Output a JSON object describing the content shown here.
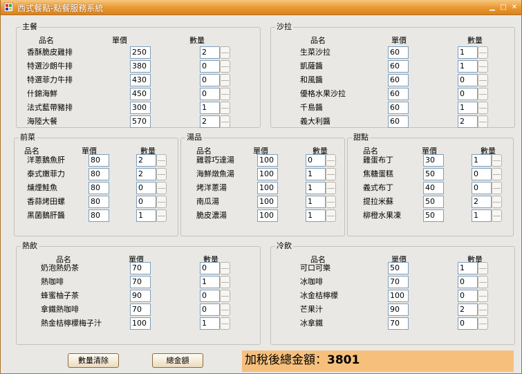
{
  "window": {
    "title": "西式餐點-點餐服務系統"
  },
  "columns": {
    "name": "品名",
    "price": "單價",
    "qty": "數量"
  },
  "groups": {
    "main": {
      "title": "主餐",
      "items": [
        {
          "name": "香酥脆皮雞排",
          "price": "250",
          "qty": "2"
        },
        {
          "name": "特選沙朗牛排",
          "price": "380",
          "qty": "0"
        },
        {
          "name": "特選菲力牛排",
          "price": "430",
          "qty": "0"
        },
        {
          "name": "什錦海鮮",
          "price": "450",
          "qty": "0"
        },
        {
          "name": "法式藍帶豬排",
          "price": "300",
          "qty": "1"
        },
        {
          "name": "海陸大餐",
          "price": "570",
          "qty": "2"
        }
      ]
    },
    "salad": {
      "title": "沙拉",
      "items": [
        {
          "name": "生菜沙拉",
          "price": "60",
          "qty": "1"
        },
        {
          "name": "凱薩醬",
          "price": "60",
          "qty": "1"
        },
        {
          "name": "和風醬",
          "price": "60",
          "qty": "0"
        },
        {
          "name": "優格水果沙拉",
          "price": "60",
          "qty": "0"
        },
        {
          "name": "千島醬",
          "price": "60",
          "qty": "1"
        },
        {
          "name": "義大利醬",
          "price": "60",
          "qty": "2"
        }
      ]
    },
    "starter": {
      "title": "前菜",
      "items": [
        {
          "name": "洋蔥鵝魚肝",
          "price": "80",
          "qty": "2"
        },
        {
          "name": "泰式嫩菲力",
          "price": "80",
          "qty": "2"
        },
        {
          "name": "燻煙鮭魚",
          "price": "80",
          "qty": "0"
        },
        {
          "name": "香蒜烤田螺",
          "price": "80",
          "qty": "0"
        },
        {
          "name": "黑菌鵝肝醬",
          "price": "80",
          "qty": "1"
        }
      ]
    },
    "soup": {
      "title": "湯品",
      "items": [
        {
          "name": "雞蓉巧達湯",
          "price": "100",
          "qty": "0"
        },
        {
          "name": "海鮮燉魚湯",
          "price": "100",
          "qty": "1"
        },
        {
          "name": "烤洋蔥湯",
          "price": "100",
          "qty": "1"
        },
        {
          "name": "南瓜湯",
          "price": "100",
          "qty": "1"
        },
        {
          "name": "脆皮濃湯",
          "price": "100",
          "qty": "1"
        }
      ]
    },
    "dessert": {
      "title": "甜點",
      "items": [
        {
          "name": "雞蛋布丁",
          "price": "30",
          "qty": "1"
        },
        {
          "name": "焦糖蛋糕",
          "price": "50",
          "qty": "0"
        },
        {
          "name": "義式布丁",
          "price": "40",
          "qty": "0"
        },
        {
          "name": "提拉米蘇",
          "price": "50",
          "qty": "2"
        },
        {
          "name": "柳橙水果凍",
          "price": "50",
          "qty": "1"
        }
      ]
    },
    "hot": {
      "title": "熱飲",
      "items": [
        {
          "name": "奶泡熱奶茶",
          "price": "70",
          "qty": "0"
        },
        {
          "name": "熱咖啡",
          "price": "70",
          "qty": "1"
        },
        {
          "name": "蜂蜜柚子茶",
          "price": "90",
          "qty": "0"
        },
        {
          "name": "拿鐵熱咖啡",
          "price": "70",
          "qty": "0"
        },
        {
          "name": "熱金桔檸檬梅子汁",
          "price": "100",
          "qty": "1"
        }
      ]
    },
    "cold": {
      "title": "冷飲",
      "items": [
        {
          "name": "可口可樂",
          "price": "50",
          "qty": "1"
        },
        {
          "name": "冰咖啡",
          "price": "70",
          "qty": "0"
        },
        {
          "name": "冰金桔檸檬",
          "price": "100",
          "qty": "0"
        },
        {
          "name": "芒果汁",
          "price": "90",
          "qty": "2"
        },
        {
          "name": "冰拿鐵",
          "price": "70",
          "qty": "0"
        }
      ]
    }
  },
  "buttons": {
    "clear": "數量清除",
    "total": "總金額"
  },
  "total": {
    "label": "加稅後總金額：",
    "value": "3801"
  },
  "colors": {
    "titlebar": "#e9972e",
    "total_bg": "#f6c07c",
    "window_bg": "#e9e8e4"
  }
}
